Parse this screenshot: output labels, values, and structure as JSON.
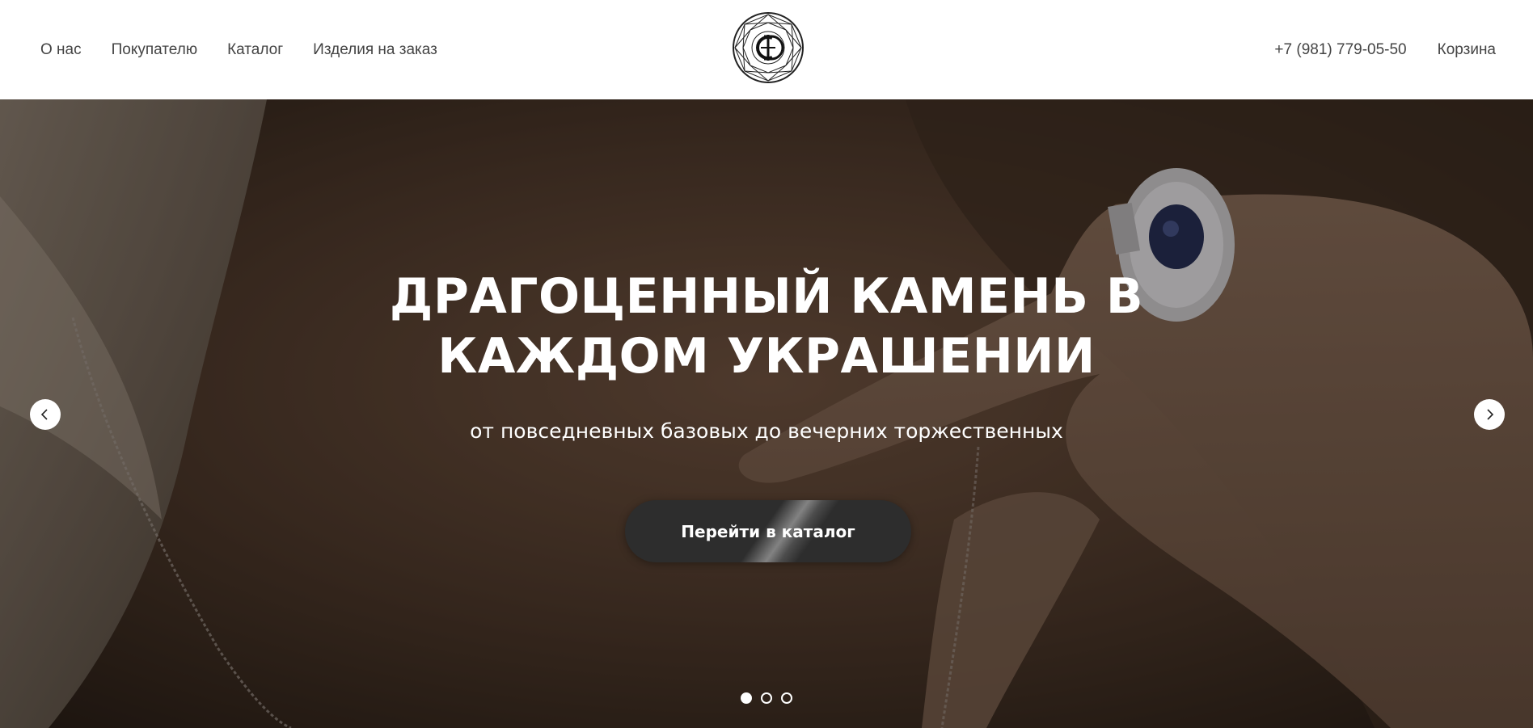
{
  "header": {
    "nav_left": [
      {
        "label": "О нас"
      },
      {
        "label": "Покупателю"
      },
      {
        "label": "Каталог"
      },
      {
        "label": "Изделия на заказ"
      }
    ],
    "phone": "+7 (981) 779-05-50",
    "cart_label": "Корзина",
    "logo_icon": "diamond-monogram-logo"
  },
  "hero": {
    "title": "ДРАГОЦЕННЫЙ КАМЕНЬ В КАЖДОМ УКРАШЕНИИ",
    "subtitle": "от повседневных базовых до вечерних торжественных",
    "cta_label": "Перейти в каталог",
    "prev_icon": "chevron-left-icon",
    "next_icon": "chevron-right-icon",
    "slide_count": 3,
    "active_slide": 1
  },
  "colors": {
    "header_bg": "#ffffff",
    "nav_text": "#444444",
    "hero_text": "#ffffff",
    "button_bg": "#2d2d2d"
  }
}
